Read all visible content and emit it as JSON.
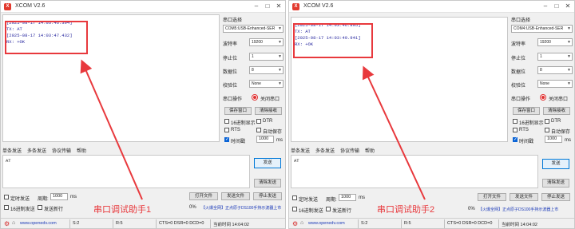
{
  "windows": [
    {
      "title": "XCOM V2.6",
      "receive_lines": [
        "[2025-08-17 14:03:46.394]",
        "TX: AT",
        "[2025-08-17 14:03:47.432]",
        "RX: +OK"
      ],
      "port_label": "串口选择",
      "port_value": "COM5:USB-Enhanced-SER",
      "baud_label": "波特率",
      "baud_value": "19200",
      "stop_label": "停止位",
      "stop_value": "1",
      "data_label": "数据位",
      "data_value": "8",
      "parity_label": "校验位",
      "parity_value": "None",
      "op_label": "串口操作",
      "close_port": "关闭串口",
      "save_window": "保存窗口",
      "clear_recv": "清除接收",
      "hex_display": "16进制显示",
      "dtr": "DTR",
      "rts": "RTS",
      "auto_save": "自动保存",
      "timestamp": "时间戳",
      "timestamp_value": "1000",
      "ms": "ms",
      "tabs": [
        "单条发送",
        "多条发送",
        "协议传输",
        "帮助"
      ],
      "send_text": "AT",
      "send_button": "发送",
      "clear_send": "清除发送",
      "timed_send": "定时发送",
      "period_label": "周期:",
      "period_value": "1000",
      "hex_send": "16进制发送",
      "newline": "发送新行",
      "open_file": "打开文件",
      "send_file": "发送文件",
      "stop_send": "停止发送",
      "percent": "0%",
      "ad": "【火爆全网】正点原子DS100手持示波器上市",
      "website": "www.openedv.com",
      "s_count": "S:2",
      "r_count": "R:5",
      "lines": "CTS=0 DSR=0 DCD=0",
      "time": "当前时间 14:04:02",
      "caption": "串口调试助手1"
    },
    {
      "title": "XCOM V2.6",
      "receive_lines": [
        "[2025-08-17 14:03:46.895]",
        "TX: AT",
        "[2025-08-17 14:03:49.941]",
        "RX: +OK"
      ],
      "port_label": "串口选择",
      "port_value": "COM4:USB-Enhanced-SER",
      "baud_label": "波特率",
      "baud_value": "19200",
      "stop_label": "停止位",
      "stop_value": "1",
      "data_label": "数据位",
      "data_value": "8",
      "parity_label": "校验位",
      "parity_value": "None",
      "op_label": "串口操作",
      "close_port": "关闭串口",
      "save_window": "保存窗口",
      "clear_recv": "清除接收",
      "hex_display": "16进制显示",
      "dtr": "DTR",
      "rts": "RTS",
      "auto_save": "自动保存",
      "timestamp": "时间戳",
      "timestamp_value": "1000",
      "ms": "ms",
      "tabs": [
        "单条发送",
        "多条发送",
        "协议传输",
        "帮助"
      ],
      "send_text": "AT",
      "send_button": "发送",
      "clear_send": "清除发送",
      "timed_send": "定时发送",
      "period_label": "周期:",
      "period_value": "1000",
      "hex_send": "16进制发送",
      "newline": "发送新行",
      "open_file": "打开文件",
      "send_file": "发送文件",
      "stop_send": "停止发送",
      "percent": "0%",
      "ad": "【火爆全网】正点原子DS100手持示波器上市",
      "website": "www.openedv.com",
      "s_count": "S:2",
      "r_count": "R:5",
      "lines": "CTS=0 DSR=0 DCD=0",
      "time": "当前时间 14:04:02",
      "caption": "串口调试助手2"
    }
  ],
  "colors": {
    "annotation": "#e8393d",
    "radio_on": "#e03030",
    "link": "#1a39b8"
  },
  "icons": [
    "gear-icon",
    "home-icon",
    "minimize-icon",
    "maximize-icon",
    "close-icon",
    "chevron-down-icon"
  ]
}
